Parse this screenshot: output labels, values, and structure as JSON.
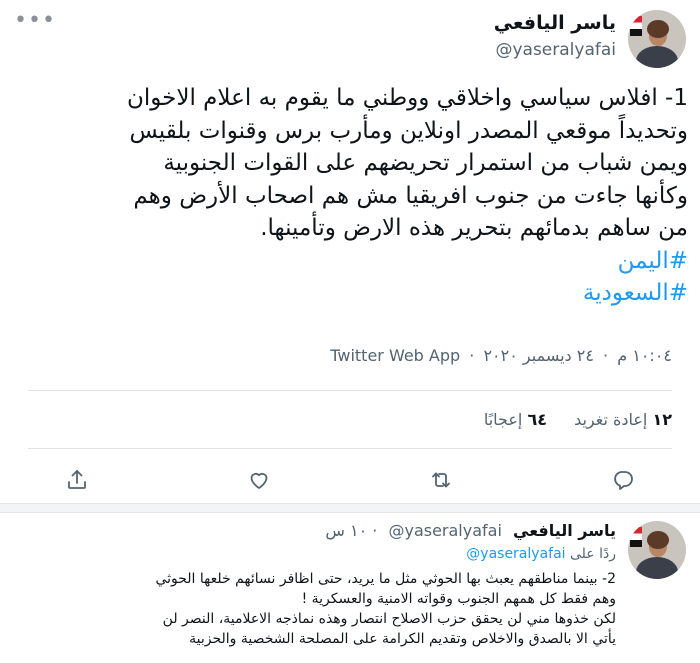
{
  "tweet": {
    "more_icon": "more-dots-icon",
    "author_name": "ياسر اليافعي",
    "author_handle": "@yaseralyafai",
    "lines": [
      "1- افلاس سياسي واخلاقي ووطني ما يقوم به اعلام الاخوان",
      "وتحديداً موقعي المصدر اونلاين ومأرب برس وقنوات بلقيس",
      "ويمن شباب من استمرار تحريضهم على القوات الجنوبية",
      "وكأنها جاءت من جنوب افريقيا مش هم اصحاب الأرض وهم",
      "من ساهم بدمائهم بتحرير هذه الارض وتأمينها."
    ],
    "hashtags": [
      "#اليمن",
      "#السعودية"
    ],
    "time": "١٠:٠٤ م",
    "date": "٢٤ ديسمبر ٢٠٢٠",
    "source": "Twitter Web App",
    "separator": "·",
    "retweets_count": "١٢",
    "retweets_label": "إعادة تغريد",
    "likes_count": "٦٤",
    "likes_label": "إعجابًا",
    "actions": [
      {
        "name": "reply-icon"
      },
      {
        "name": "retweet-icon"
      },
      {
        "name": "like-icon"
      },
      {
        "name": "share-icon"
      }
    ]
  },
  "reply": {
    "author_name": "ياسر اليافعي",
    "author_handle": "@yaseralyafai",
    "separator": "·",
    "time_ago": "١٠ س",
    "replying_label": "ردًا على",
    "replying_to": "@yaseralyafai",
    "lines": [
      "2- بينما مناطقهم يعبث بها الحوثي مثل ما  يريد، حتى اظافر نسائهم خلعها الحوثي",
      "وهم فقط كل همهم الجنوب وقواته الامنية والعسكرية !",
      "لكن خذوها مني لن يحقق حزب الاصلاح انتصار وهذه نماذجه الاعلامية، النصر لن",
      "يأتي الا بالصدق والاخلاص وتقديم الكرامة على المصلحة الشخصية والحزبية"
    ]
  }
}
